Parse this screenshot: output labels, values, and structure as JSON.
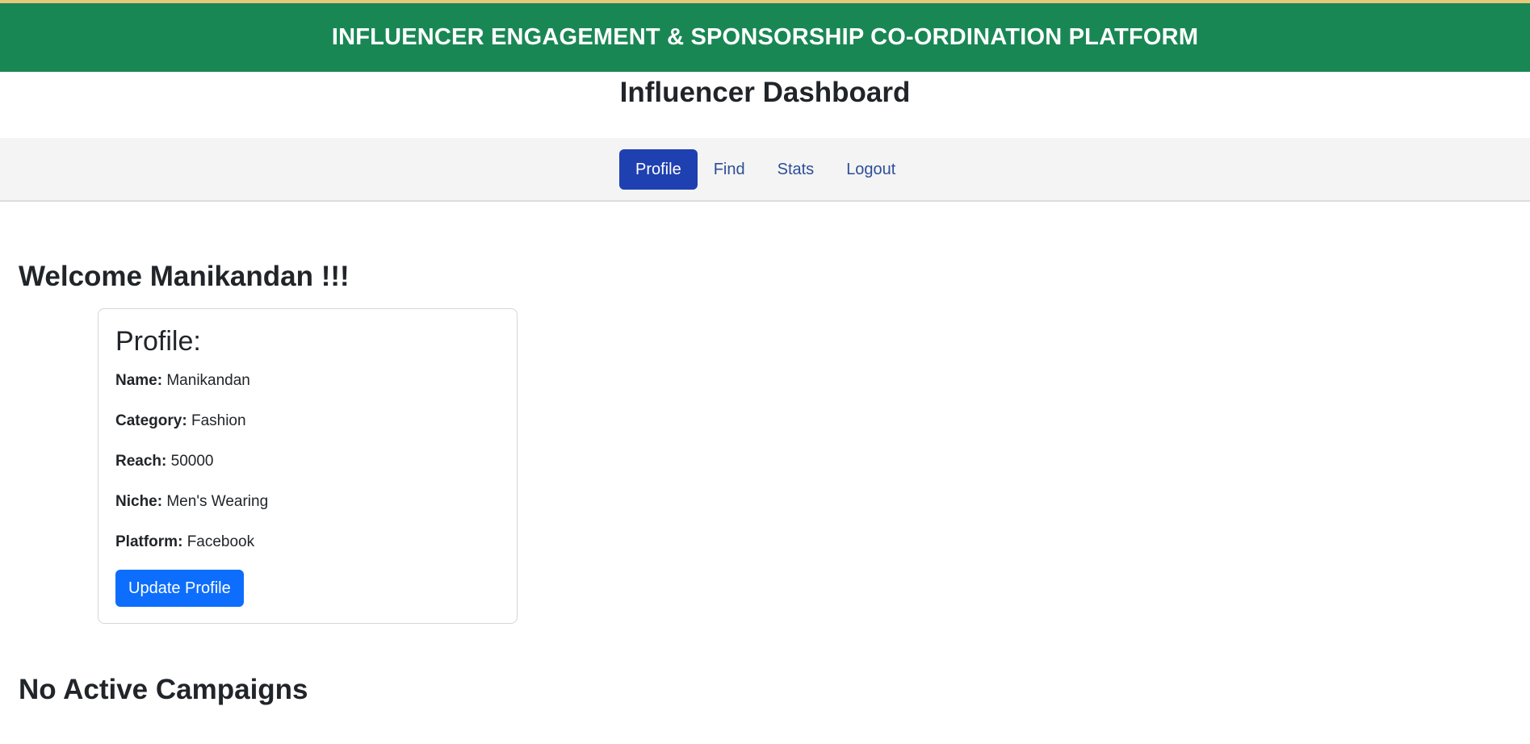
{
  "banner": {
    "title": "INFLUENCER ENGAGEMENT & SPONSORSHIP CO-ORDINATION PLATFORM",
    "color": "#198754"
  },
  "page": {
    "title": "Influencer Dashboard"
  },
  "nav": {
    "items": [
      {
        "label": "Profile",
        "active": true
      },
      {
        "label": "Find",
        "active": false
      },
      {
        "label": "Stats",
        "active": false
      },
      {
        "label": "Logout",
        "active": false
      }
    ],
    "active_color": "#1f40b0"
  },
  "welcome": {
    "text": "Welcome Manikandan !!!"
  },
  "profile": {
    "title": "Profile:",
    "fields": [
      {
        "label": "Name:",
        "value": "Manikandan"
      },
      {
        "label": "Category:",
        "value": "Fashion"
      },
      {
        "label": "Reach:",
        "value": "50000"
      },
      {
        "label": "Niche:",
        "value": "Men's Wearing"
      },
      {
        "label": "Platform:",
        "value": "Facebook"
      }
    ],
    "update_button": "Update Profile",
    "button_color": "#0d6efd"
  },
  "campaigns": {
    "empty_text": "No Active Campaigns"
  }
}
